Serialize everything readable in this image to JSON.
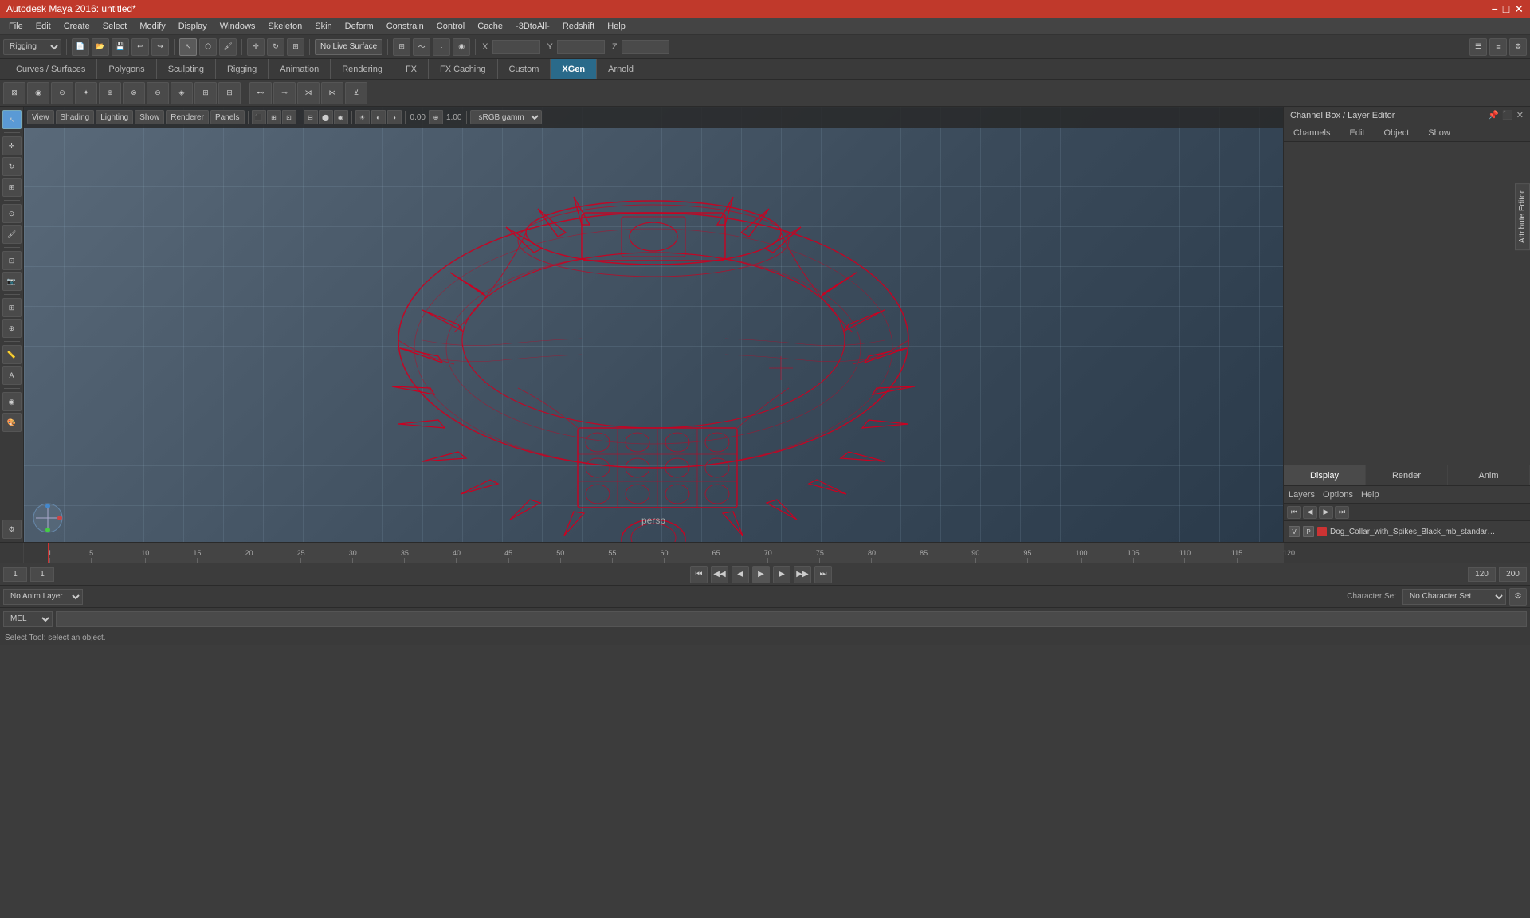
{
  "app": {
    "title": "Autodesk Maya 2016: untitled*",
    "window_controls": [
      "−",
      "□",
      "✕"
    ]
  },
  "menu": {
    "items": [
      "File",
      "Edit",
      "Create",
      "Select",
      "Modify",
      "Display",
      "Windows",
      "Skeleton",
      "Skin",
      "Deform",
      "Constrain",
      "Control",
      "Cache",
      "-3DtoAll-",
      "Redshift",
      "Help"
    ]
  },
  "toolbar1": {
    "mode_label": "Rigging",
    "no_live_surface": "No Live Surface",
    "x_label": "X",
    "y_label": "Y",
    "z_label": "Z"
  },
  "tabs": {
    "items": [
      "Curves / Surfaces",
      "Polygons",
      "Sculpting",
      "Rigging",
      "Animation",
      "Rendering",
      "FX",
      "FX Caching",
      "Custom",
      "XGen",
      "Arnold"
    ]
  },
  "viewport": {
    "toolbar": {
      "items": [
        "View",
        "Shading",
        "Lighting",
        "Show",
        "Renderer",
        "Panels"
      ],
      "value1": "0.00",
      "value2": "1.00",
      "color_space": "sRGB gamma"
    },
    "label": "persp"
  },
  "channel_box": {
    "title": "Channel Box / Layer Editor",
    "tabs": [
      "Channels",
      "Edit",
      "Object",
      "Show"
    ],
    "bottom_tabs": [
      "Display",
      "Render",
      "Anim"
    ],
    "sub_tabs": [
      "Layers",
      "Options",
      "Help"
    ],
    "layer_item": {
      "vis": "V",
      "playback": "P",
      "color": "#cc3333",
      "name": "Dog_Collar_with_Spikes_Black_mb_standart:Dog_Collar_"
    }
  },
  "timeline": {
    "start": "1",
    "end": "120",
    "ticks": [
      "1",
      "5",
      "10",
      "15",
      "20",
      "25",
      "30",
      "35",
      "40",
      "45",
      "50",
      "55",
      "60",
      "65",
      "70",
      "75",
      "80",
      "85",
      "90",
      "95",
      "100",
      "105",
      "110",
      "115",
      "120"
    ]
  },
  "range_bar": {
    "start_frame": "1",
    "current_frame": "1",
    "range_start": "1",
    "range_end": "120",
    "end_frame": "200",
    "anim_layer": "No Anim Layer",
    "character_set": "No Character Set"
  },
  "command_bar": {
    "mode": "MEL",
    "placeholder": ""
  },
  "status_bar": {
    "message": "Select Tool: select an object."
  },
  "icons": {
    "select": "▶",
    "move": "✛",
    "rotate": "↻",
    "scale": "⊞",
    "play": "▶",
    "pause": "⏸",
    "stop": "⏹",
    "step_back": "⏮",
    "step_fwd": "⏭",
    "first": "⏮",
    "last": "⏭",
    "prev_key": "◀◀",
    "next_key": "▶▶"
  }
}
